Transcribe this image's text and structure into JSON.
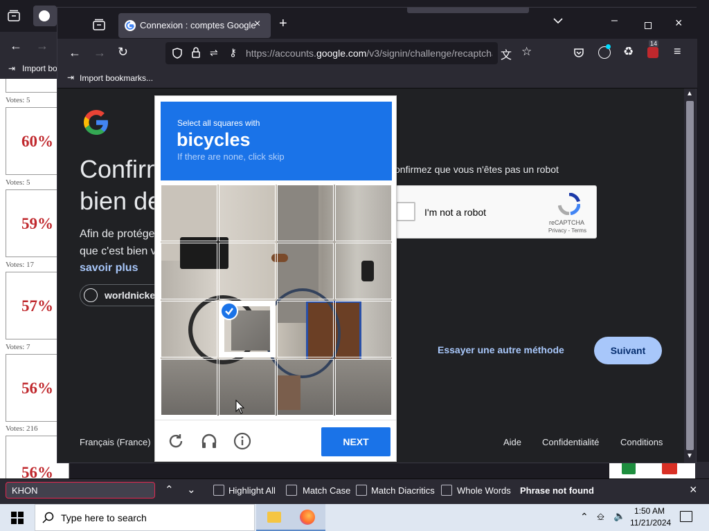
{
  "bg_window": {
    "bookmark_label": "Import bo",
    "polls": [
      {
        "votes": "Votes: 5",
        "percent": "60%"
      },
      {
        "votes": "Votes: 5",
        "percent": "59%"
      },
      {
        "votes": "Votes: 17",
        "percent": "57%"
      },
      {
        "votes": "Votes: 7",
        "percent": "56%"
      },
      {
        "votes": "Votes: 216",
        "percent": "56%"
      }
    ]
  },
  "browser": {
    "tab_title": "Connexion : comptes Google",
    "url_prefix": "https://accounts.",
    "url_domain": "google.com",
    "url_path": "/v3/signin/challenge/recaptcha",
    "bookmarks_label": "Import bookmarks...",
    "extension_badge": "14"
  },
  "google_page": {
    "title_line1": "Confirm",
    "title_line2": "bien de",
    "body_line1": "Afin de protége",
    "body_line2": "que c'est bien v",
    "link": "savoir plus",
    "account": "worldnicke",
    "instruction": "onfirmez que vous n'êtes pas un robot",
    "checkbox_label": "I'm not a robot",
    "recaptcha_brand": "reCAPTCHA",
    "recaptcha_links": "Privacy - Terms",
    "try_another": "Essayer une autre méthode",
    "next_button": "Suivant",
    "language": "Français (France)",
    "footer_links": [
      "Aide",
      "Confidentialité",
      "Conditions"
    ]
  },
  "captcha": {
    "prompt": "Select all squares with",
    "object": "bicycles",
    "hint": "If there are none, click skip",
    "next_button": "NEXT",
    "selected_tile": "row 3, column 2"
  },
  "findbar": {
    "query": "KHON",
    "options": [
      "Highlight All",
      "Match Case",
      "Match Diacritics",
      "Whole Words"
    ],
    "status": "Phrase not found"
  },
  "taskbar": {
    "search_placeholder": "Type here to search",
    "time": "1:50 AM",
    "date": "11/21/2024"
  },
  "colors": {
    "captcha_blue": "#1a73e8",
    "google_blue_button": "#a8c7fa",
    "page_bg": "#202124",
    "poll_red": "#c0282d"
  }
}
